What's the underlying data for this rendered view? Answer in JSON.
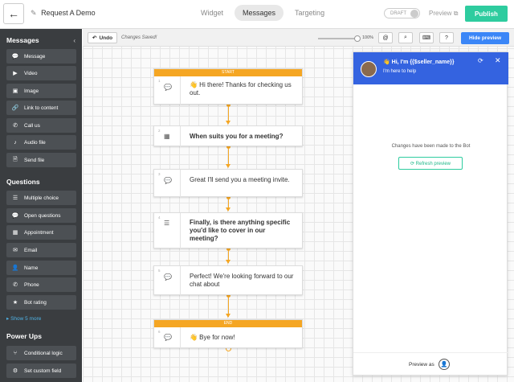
{
  "header": {
    "back_icon": "←",
    "edit_icon": "✎",
    "title": "Request A Demo",
    "tabs": [
      "Widget",
      "Messages",
      "Targeting"
    ],
    "active_tab": "Messages",
    "draft_label": "DRAFT",
    "preview_label": "Preview",
    "preview_icon": "⧉",
    "publish_label": "Publish"
  },
  "sidebar": {
    "collapse_icon": "‹",
    "messages_title": "Messages",
    "messages": [
      {
        "label": "Message",
        "icon": "💬"
      },
      {
        "label": "Video",
        "icon": "▶"
      },
      {
        "label": "Image",
        "icon": "▣"
      },
      {
        "label": "Link to content",
        "icon": "🔗"
      },
      {
        "label": "Call us",
        "icon": "✆"
      },
      {
        "label": "Audio file",
        "icon": "♪"
      },
      {
        "label": "Send file",
        "icon": "🗎"
      }
    ],
    "questions_title": "Questions",
    "questions": [
      {
        "label": "Multiple choice",
        "icon": "☰"
      },
      {
        "label": "Open questions",
        "icon": "💬"
      },
      {
        "label": "Appointment",
        "icon": "▦"
      },
      {
        "label": "Email",
        "icon": "✉"
      },
      {
        "label": "Name",
        "icon": "👤"
      },
      {
        "label": "Phone",
        "icon": "✆"
      },
      {
        "label": "Bot rating",
        "icon": "★"
      }
    ],
    "show_more": "▸ Show 5 more",
    "powerups_title": "Power Ups",
    "powerups": [
      {
        "label": "Conditional logic",
        "icon": "⑂"
      },
      {
        "label": "Set custom field",
        "icon": "⚙"
      }
    ]
  },
  "toolbar": {
    "undo_label": "Undo",
    "undo_icon": "↶",
    "saved_text": "Changes Saved!",
    "zoom": "100%",
    "mention_icon": "@",
    "search_icon": "⌕",
    "keyboard_icon": "⌨",
    "help_icon": "?",
    "hide_preview_label": "Hide preview"
  },
  "flow": [
    {
      "num": "1",
      "tag": "START",
      "icon": "💬",
      "text": "👋 Hi there! Thanks for checking us out.",
      "bold": false
    },
    {
      "num": "2",
      "tag": "",
      "icon": "▦",
      "text": "When suits you for a meeting?",
      "bold": true
    },
    {
      "num": "3",
      "tag": "",
      "icon": "💬",
      "text": "Great I'll send you a meeting invite.",
      "bold": false
    },
    {
      "num": "4",
      "tag": "",
      "icon": "☰",
      "text": "Finally, is there anything specific you'd like to cover in our meeting?",
      "bold": true
    },
    {
      "num": "5",
      "tag": "",
      "icon": "💬",
      "text": "Perfect! We're looking forward to our chat about",
      "bold": false
    },
    {
      "num": "6",
      "tag": "END",
      "icon": "💬",
      "text": "👋 Bye for now!",
      "bold": false
    }
  ],
  "preview": {
    "greeting": "👋 Hi, I'm {{$seller_name}}",
    "subtitle": "I'm here to help",
    "refresh_icon": "⟳",
    "close_icon": "✕",
    "changes_text": "Changes have been made to the Bot",
    "refresh_label": "⟳  Refresh preview",
    "preview_as": "Preview as",
    "user_icon": "👤"
  },
  "colors": {
    "accent": "#3b86f7",
    "publish": "#2ecc9f",
    "flow": "#f5a623",
    "sidebar": "#3a3d40"
  }
}
